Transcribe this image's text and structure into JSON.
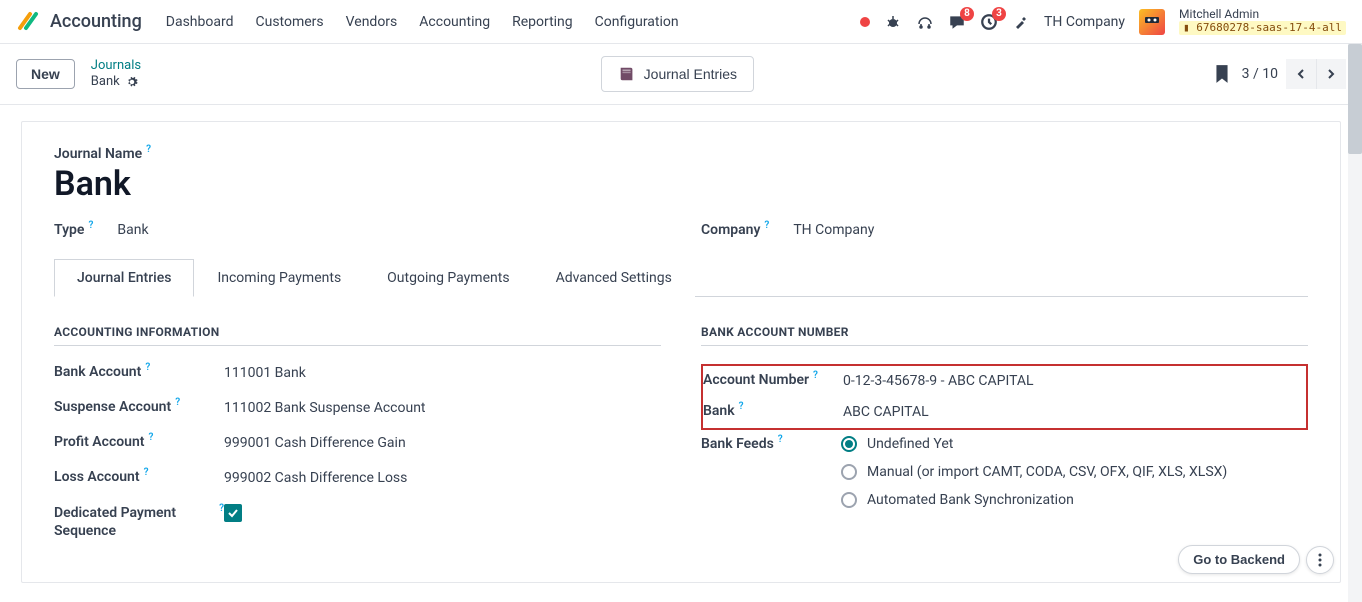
{
  "app": {
    "name": "Accounting"
  },
  "nav": {
    "items": [
      "Dashboard",
      "Customers",
      "Vendors",
      "Accounting",
      "Reporting",
      "Configuration"
    ],
    "company": "TH Company",
    "user_name": "Mitchell Admin",
    "db_tag": "67680278-saas-17-4-all",
    "msg_badge": "8",
    "activity_badge": "3"
  },
  "control": {
    "new_label": "New",
    "breadcrumb_top": "Journals",
    "breadcrumb_current": "Bank",
    "stat_btn": "Journal Entries",
    "pager": "3 / 10"
  },
  "form": {
    "journal_name_label": "Journal Name",
    "journal_name_value": "Bank",
    "type_label": "Type",
    "type_value": "Bank",
    "company_label": "Company",
    "company_value": "TH Company",
    "tabs": [
      "Journal Entries",
      "Incoming Payments",
      "Outgoing Payments",
      "Advanced Settings"
    ],
    "left": {
      "section": "ACCOUNTING INFORMATION",
      "bank_account_label": "Bank Account",
      "bank_account_value": "111001 Bank",
      "suspense_label": "Suspense Account",
      "suspense_value": "111002 Bank Suspense Account",
      "profit_label": "Profit Account",
      "profit_value": "999001 Cash Difference Gain",
      "loss_label": "Loss Account",
      "loss_value": "999002 Cash Difference Loss",
      "dedicated_label": "Dedicated Payment Sequence"
    },
    "right": {
      "section": "BANK ACCOUNT NUMBER",
      "acct_num_label": "Account Number",
      "acct_num_value": "0-12-3-45678-9 - ABC CAPITAL",
      "bank_label": "Bank",
      "bank_value": "ABC CAPITAL",
      "feeds_label": "Bank Feeds",
      "feed_opt1": "Undefined Yet",
      "feed_opt2": "Manual (or import CAMT, CODA, CSV, OFX, QIF, XLS, XLSX)",
      "feed_opt3": "Automated Bank Synchronization"
    }
  },
  "float": {
    "backend": "Go to Backend"
  },
  "help": "?"
}
